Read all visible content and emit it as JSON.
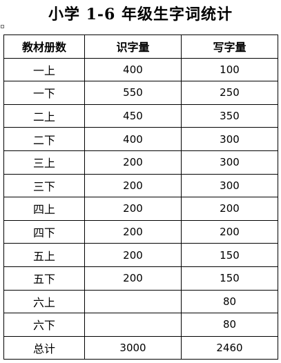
{
  "document": {
    "title": "小学 1-6 年级生字词统计"
  },
  "table": {
    "headers": [
      "教材册数",
      "识字量",
      "写字量"
    ],
    "rows": [
      {
        "book": "一上",
        "recognize": "400",
        "write": "100"
      },
      {
        "book": "一下",
        "recognize": "550",
        "write": "250"
      },
      {
        "book": "二上",
        "recognize": "450",
        "write": "350"
      },
      {
        "book": "二下",
        "recognize": "400",
        "write": "300"
      },
      {
        "book": "三上",
        "recognize": "200",
        "write": "300"
      },
      {
        "book": "三下",
        "recognize": "200",
        "write": "300"
      },
      {
        "book": "四上",
        "recognize": "200",
        "write": "200"
      },
      {
        "book": "四下",
        "recognize": "200",
        "write": "200"
      },
      {
        "book": "五上",
        "recognize": "200",
        "write": "150"
      },
      {
        "book": "五下",
        "recognize": "200",
        "write": "150"
      },
      {
        "book": "六上",
        "recognize": "",
        "write": "80"
      },
      {
        "book": "六下",
        "recognize": "",
        "write": "80"
      },
      {
        "book": "总计",
        "recognize": "3000",
        "write": "2460"
      }
    ]
  }
}
